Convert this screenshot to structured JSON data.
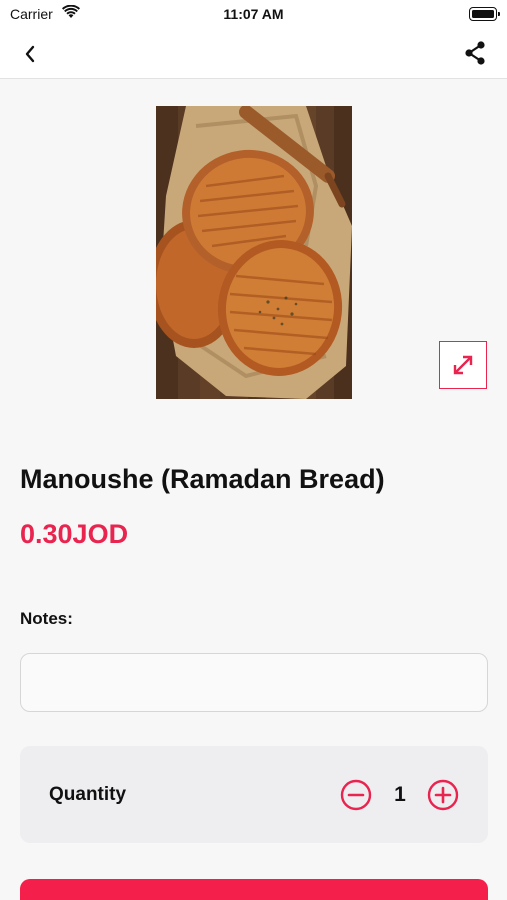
{
  "status_bar": {
    "carrier": "Carrier",
    "time": "11:07 AM"
  },
  "nav": {
    "back_icon": "chevron-left-icon",
    "share_icon": "share-icon"
  },
  "product": {
    "image_alt": "flatbread-photo",
    "name": "Manoushe (Ramadan Bread)",
    "price": "0.30JOD",
    "expand_icon": "expand-arrows-icon"
  },
  "notes": {
    "label": "Notes:",
    "value": "",
    "placeholder": ""
  },
  "quantity": {
    "label": "Quantity",
    "value": "1",
    "minus_icon": "minus-circle-icon",
    "plus_icon": "plus-circle-icon"
  },
  "colors": {
    "accent": "#e8244f",
    "button": "#f41f4a",
    "background": "#f7f7f7",
    "card": "#eeeef1"
  }
}
